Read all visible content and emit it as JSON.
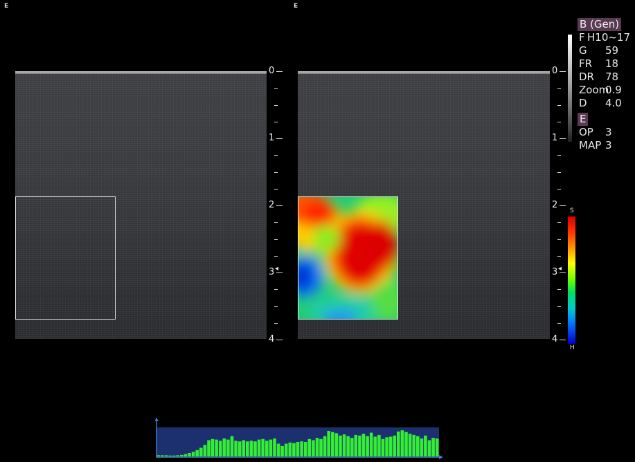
{
  "panes": {
    "left_mark": "E",
    "right_mark": "E"
  },
  "depth_scale": {
    "labels": [
      "0",
      "1",
      "2",
      "3",
      "4"
    ],
    "focus_marker": "◂"
  },
  "info": {
    "mode_title": "B (Gen)",
    "rows": [
      {
        "key": "F",
        "value": "H10~17"
      },
      {
        "key": "G",
        "value": "59"
      },
      {
        "key": "FR",
        "value": "18"
      },
      {
        "key": "DR",
        "value": "78"
      },
      {
        "key": "Zoom",
        "value": "0.9"
      },
      {
        "key": "D",
        "value": "4.0"
      }
    ],
    "elasto_title": "E",
    "elasto_rows": [
      {
        "key": "OP",
        "value": "3"
      },
      {
        "key": "MAP",
        "value": "3"
      }
    ]
  },
  "colorbar": {
    "top_label": "S",
    "bottom_label": "H"
  },
  "histogram": {
    "values": [
      0.04,
      0.04,
      0.04,
      0.03,
      0.03,
      0.04,
      0.05,
      0.08,
      0.12,
      0.16,
      0.22,
      0.3,
      0.4,
      0.56,
      0.6,
      0.58,
      0.54,
      0.62,
      0.58,
      0.7,
      0.54,
      0.52,
      0.56,
      0.52,
      0.54,
      0.52,
      0.58,
      0.6,
      0.54,
      0.58,
      0.62,
      0.44,
      0.36,
      0.44,
      0.48,
      0.46,
      0.5,
      0.52,
      0.5,
      0.6,
      0.56,
      0.64,
      0.6,
      0.7,
      0.88,
      0.84,
      0.8,
      0.72,
      0.76,
      0.7,
      0.64,
      0.74,
      0.72,
      0.78,
      0.7,
      0.82,
      0.68,
      0.74,
      0.6,
      0.66,
      0.68,
      0.72,
      0.86,
      0.9,
      0.84,
      0.78,
      0.74,
      0.7,
      0.62,
      0.72,
      0.56,
      0.64,
      0.62
    ],
    "bar_color": "#33ee33",
    "band_color": "#1c3070"
  },
  "colors": {
    "background": "#000000",
    "roi_border": "#e6e6e6",
    "info_title_bg": "#5a3a52"
  }
}
